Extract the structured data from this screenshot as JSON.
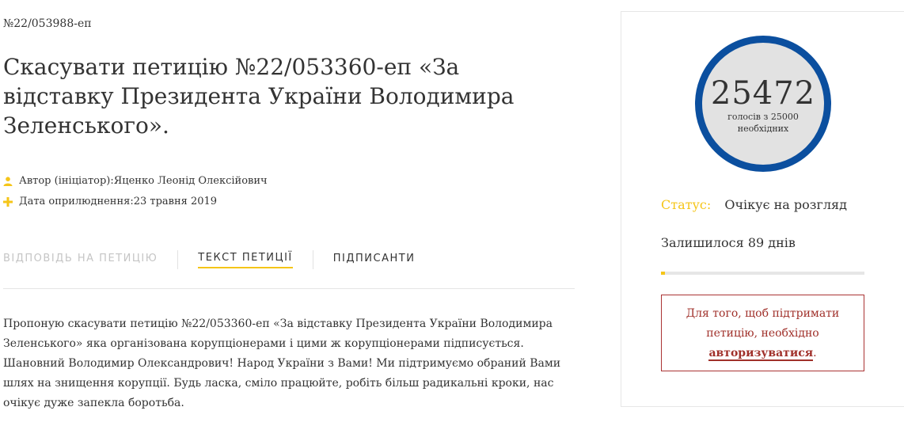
{
  "petition": {
    "number": "№22/053988-еп",
    "title": "Скасувати петицію №22/053360-еп «За відставку Президента України Володимира Зеленського».",
    "author_label": "Автор (ініціатор): ",
    "author": "Яценко Леонід Олексійович",
    "date_label": "Дата оприлюднення: ",
    "date": "23 травня 2019",
    "text": "Пропоную скасувати петицію №22/053360-еп «За відставку Президента України Володимира Зеленського» яка організована корупціонерами і цими ж корупціонерами підписується. Шановний Володимир Олександрович! Народ України з Вами! Ми підтримуємо обраний Вами шлях на знищення корупції. Будь ласка, сміло працюйте, робіть більш радикальні кроки, нас очікує дуже запекла боротьба."
  },
  "tabs": [
    {
      "label": "Відповідь на петицію",
      "state": "inactive"
    },
    {
      "label": "Текст петиції",
      "state": "active"
    },
    {
      "label": "Підписанти",
      "state": "normal"
    }
  ],
  "sidebar": {
    "votes": "25472",
    "votes_caption_line1": "голосів з 25000",
    "votes_caption_line2": "необхідних",
    "status_label": "Статус:",
    "status_value": "Очікує на розгляд",
    "days_left": "Залишилося 89 днів",
    "progress_fraction": 0.02,
    "auth_text": "Для того, щоб підтримати петицію, необхідно",
    "auth_link": "авторизуватися",
    "auth_suffix": "."
  },
  "colors": {
    "accent_yellow": "#f5c518",
    "circle_blue": "#0b4f9f",
    "auth_red": "#a0302a"
  },
  "icons": {
    "author": "person-icon",
    "date": "plus-icon"
  }
}
